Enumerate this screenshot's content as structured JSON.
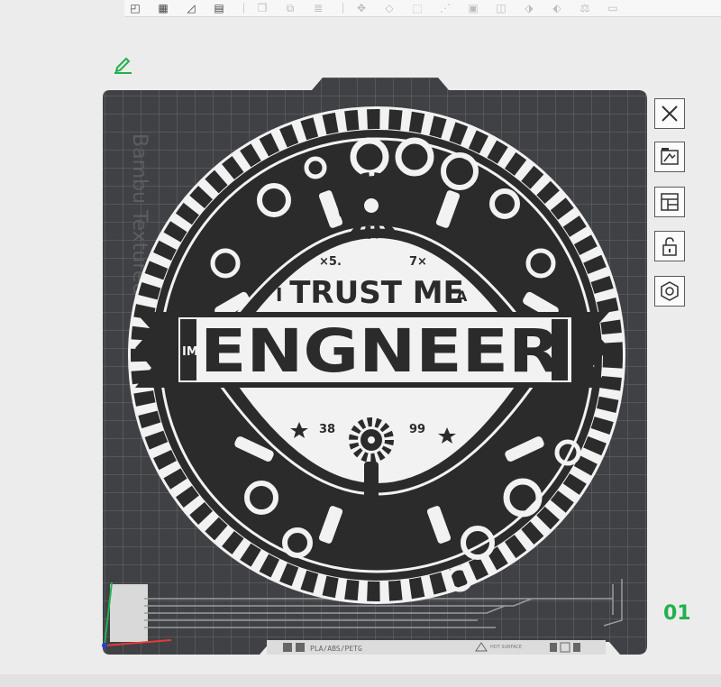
{
  "toolbar": {
    "buttons": [
      {
        "icon": "add-object-icon",
        "glyph": "◰"
      },
      {
        "icon": "arrange-grid-icon",
        "glyph": "▦"
      },
      {
        "icon": "auto-orient-icon",
        "glyph": "◿"
      },
      {
        "icon": "plate-icon",
        "glyph": "▤"
      },
      {
        "icon": "copy-icon",
        "glyph": "❐"
      },
      {
        "icon": "paste-icon",
        "glyph": "⧉"
      },
      {
        "icon": "list-icon",
        "glyph": "≣"
      },
      {
        "icon": "move-icon",
        "glyph": "✥"
      },
      {
        "icon": "rotate-icon",
        "glyph": "◇"
      },
      {
        "icon": "scale-icon",
        "glyph": "⬚"
      },
      {
        "icon": "lay-flat-icon",
        "glyph": "⋰"
      },
      {
        "icon": "cut-icon",
        "glyph": "▣"
      },
      {
        "icon": "boolean-icon",
        "glyph": "◫"
      },
      {
        "icon": "support-paint-icon",
        "glyph": "⬗"
      },
      {
        "icon": "seam-paint-icon",
        "glyph": "⬖"
      },
      {
        "icon": "measure-icon",
        "glyph": "⚖"
      },
      {
        "icon": "text-icon",
        "glyph": "▭"
      }
    ]
  },
  "plate": {
    "texture_label": "Bambu Textured PEI Plate",
    "artwork": {
      "line1": "TRUST ME",
      "line1_prefix": "I",
      "line1_suffix": "A",
      "banner_prefix": "IM",
      "banner_word": "ENGNEER",
      "top_left_mark": "×5.",
      "top_right_mark": "7×",
      "bottom_left_mark": "38",
      "bottom_right_mark": "99"
    },
    "bottom_label": {
      "material": "PLA/ABS/PETG",
      "warning": "HOT SURFACE"
    },
    "number": "01"
  },
  "side_buttons": [
    {
      "name": "close-plate-button",
      "icon": "close-icon"
    },
    {
      "name": "auto-orient-plate-button",
      "icon": "auto-orient-icon"
    },
    {
      "name": "arrange-plate-button",
      "icon": "arrange-icon"
    },
    {
      "name": "lock-plate-button",
      "icon": "lock-icon"
    },
    {
      "name": "plate-settings-button",
      "icon": "hexagon-icon"
    }
  ],
  "colors": {
    "accent_green": "#22b14c",
    "plate_dark": "#3f4144",
    "grid_line": "#6a6d70",
    "disc_white": "#f2f2f2",
    "ink": "#2b2b2b"
  }
}
